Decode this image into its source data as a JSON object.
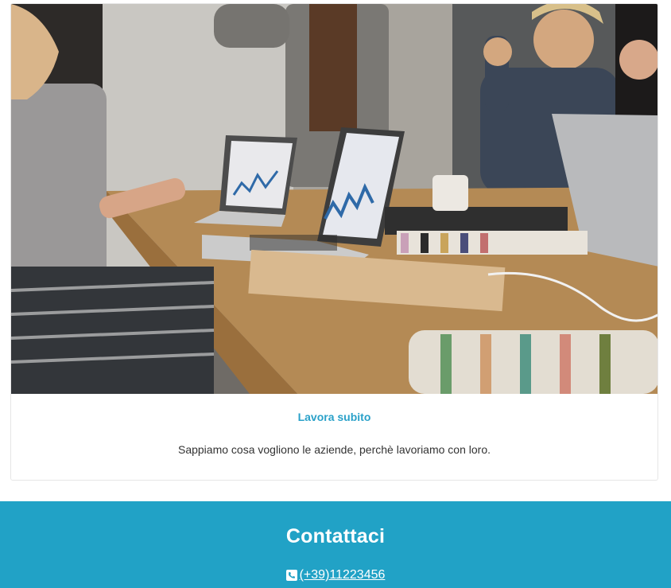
{
  "card": {
    "image_alt": "Team meeting in an office with laptops on a wooden table",
    "title": "Lavora subito",
    "description": "Sappiamo cosa vogliono le aziende, perchè lavoriamo con loro."
  },
  "contact": {
    "title": "Contattaci",
    "phone": "(+39)11223456",
    "phone_icon": "phone-square-icon"
  },
  "colors": {
    "accent": "#2aa1c9",
    "contact_bg": "#21a2c6"
  }
}
